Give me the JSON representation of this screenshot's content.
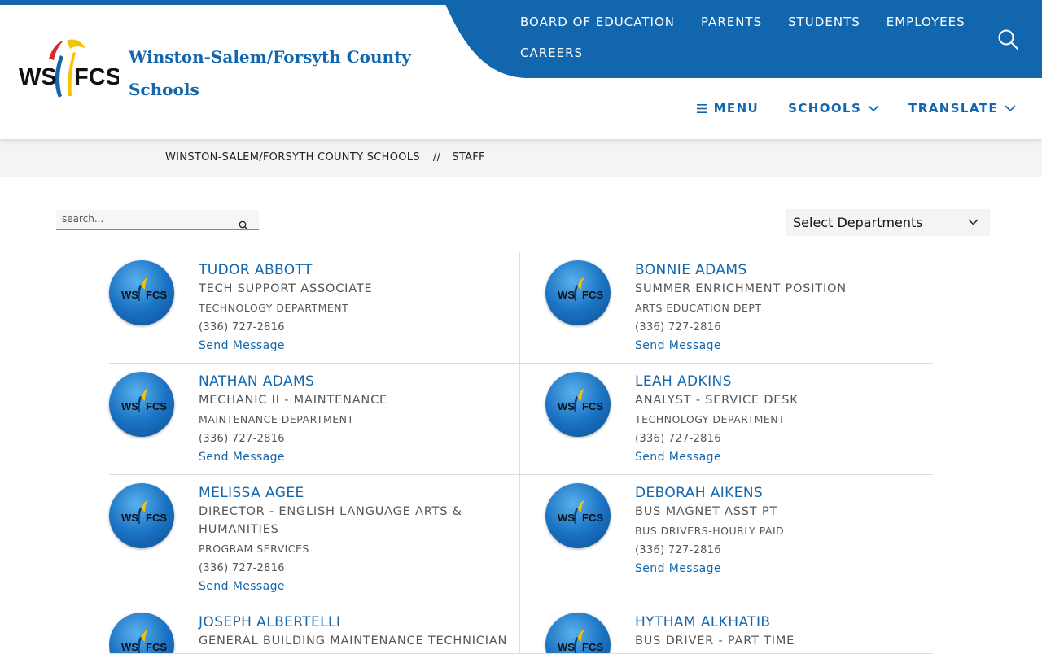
{
  "site": {
    "name": "Winston-Salem/Forsyth County Schools",
    "logo_text_left": "WS",
    "logo_text_right": "FCS"
  },
  "colors": {
    "brand_blue": "#1266ad",
    "accent_yellow": "#f5c400",
    "accent_red": "#d72a2a"
  },
  "utility_nav": [
    {
      "label": "BOARD OF EDUCATION"
    },
    {
      "label": "PARENTS"
    },
    {
      "label": "STUDENTS"
    },
    {
      "label": "EMPLOYEES"
    },
    {
      "label": "CAREERS"
    }
  ],
  "main_nav": {
    "menu_label": "MENU",
    "schools_label": "SCHOOLS",
    "translate_label": "TRANSLATE"
  },
  "breadcrumb": {
    "home": "WINSTON-SALEM/FORSYTH COUNTY SCHOOLS",
    "separator": "//",
    "current": "STAFF"
  },
  "search": {
    "placeholder": "search..."
  },
  "department_filter": {
    "selected": "Select Departments"
  },
  "staff": [
    {
      "name": "TUDOR ABBOTT",
      "title": "TECH SUPPORT ASSOCIATE",
      "department": "TECHNOLOGY DEPARTMENT",
      "phone": "(336) 727-2816",
      "action": "Send Message"
    },
    {
      "name": "BONNIE ADAMS",
      "title": "SUMMER ENRICHMENT POSITION",
      "department": "ARTS EDUCATION DEPT",
      "phone": "(336) 727-2816",
      "action": "Send Message"
    },
    {
      "name": "NATHAN ADAMS",
      "title": "MECHANIC II - MAINTENANCE",
      "department": "MAINTENANCE DEPARTMENT",
      "phone": "(336) 727-2816",
      "action": "Send Message"
    },
    {
      "name": "LEAH ADKINS",
      "title": "ANALYST - SERVICE DESK",
      "department": "TECHNOLOGY DEPARTMENT",
      "phone": "(336) 727-2816",
      "action": "Send Message"
    },
    {
      "name": "MELISSA AGEE",
      "title": "DIRECTOR - ENGLISH LANGUAGE ARTS & HUMANITIES",
      "department": "PROGRAM SERVICES",
      "phone": "(336) 727-2816",
      "action": "Send Message"
    },
    {
      "name": "DEBORAH AIKENS",
      "title": "BUS MAGNET ASST PT",
      "department": "BUS DRIVERS-HOURLY PAID",
      "phone": "(336) 727-2816",
      "action": "Send Message"
    },
    {
      "name": "JOSEPH ALBERTELLI",
      "title": "GENERAL BUILDING MAINTENANCE TECHNICIAN",
      "department": "",
      "phone": "",
      "action": ""
    },
    {
      "name": "HYTHAM ALKHATIB",
      "title": "BUS DRIVER - PART TIME",
      "department": "",
      "phone": "",
      "action": ""
    }
  ]
}
